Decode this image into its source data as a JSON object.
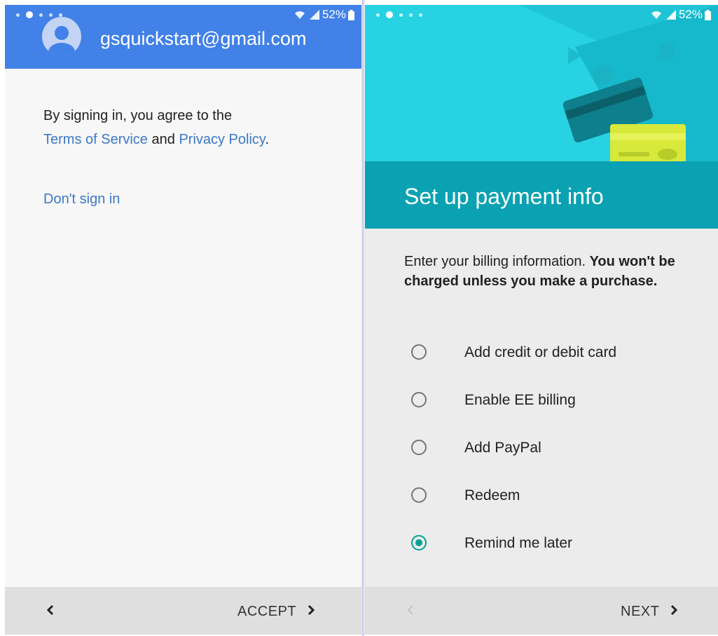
{
  "left": {
    "status": {
      "battery": "52%"
    },
    "header": {
      "email": "gsquickstart@gmail.com"
    },
    "terms": {
      "prefix": "By signing in, you agree to the",
      "tos_link": "Terms of Service",
      "conjunction": "and",
      "privacy_link": "Privacy Policy",
      "suffix": "."
    },
    "dont_sign_in": "Don't sign in",
    "bottom": {
      "action_label": "ACCEPT"
    }
  },
  "right": {
    "status": {
      "battery": "52%"
    },
    "title": "Set up payment info",
    "description": {
      "normal": "Enter your billing information.",
      "bold": "You won't be charged unless you make a purchase."
    },
    "options": [
      {
        "label": "Add credit or debit card",
        "selected": false
      },
      {
        "label": "Enable EE billing",
        "selected": false
      },
      {
        "label": "Add PayPal",
        "selected": false
      },
      {
        "label": "Redeem",
        "selected": false
      },
      {
        "label": "Remind me later",
        "selected": true
      }
    ],
    "bottom": {
      "action_label": "NEXT"
    }
  },
  "colors": {
    "header_blue": "#4181e8",
    "link_blue": "#3c78c8",
    "hero_cyan": "#27d3e3",
    "hero_band_teal": "#0aa2b2",
    "radio_selected": "#00a296"
  },
  "icons": [
    "wifi-icon",
    "signal-icon",
    "battery-icon",
    "avatar-icon",
    "chevron-left-icon",
    "chevron-right-icon",
    "credit-card-illustration"
  ]
}
